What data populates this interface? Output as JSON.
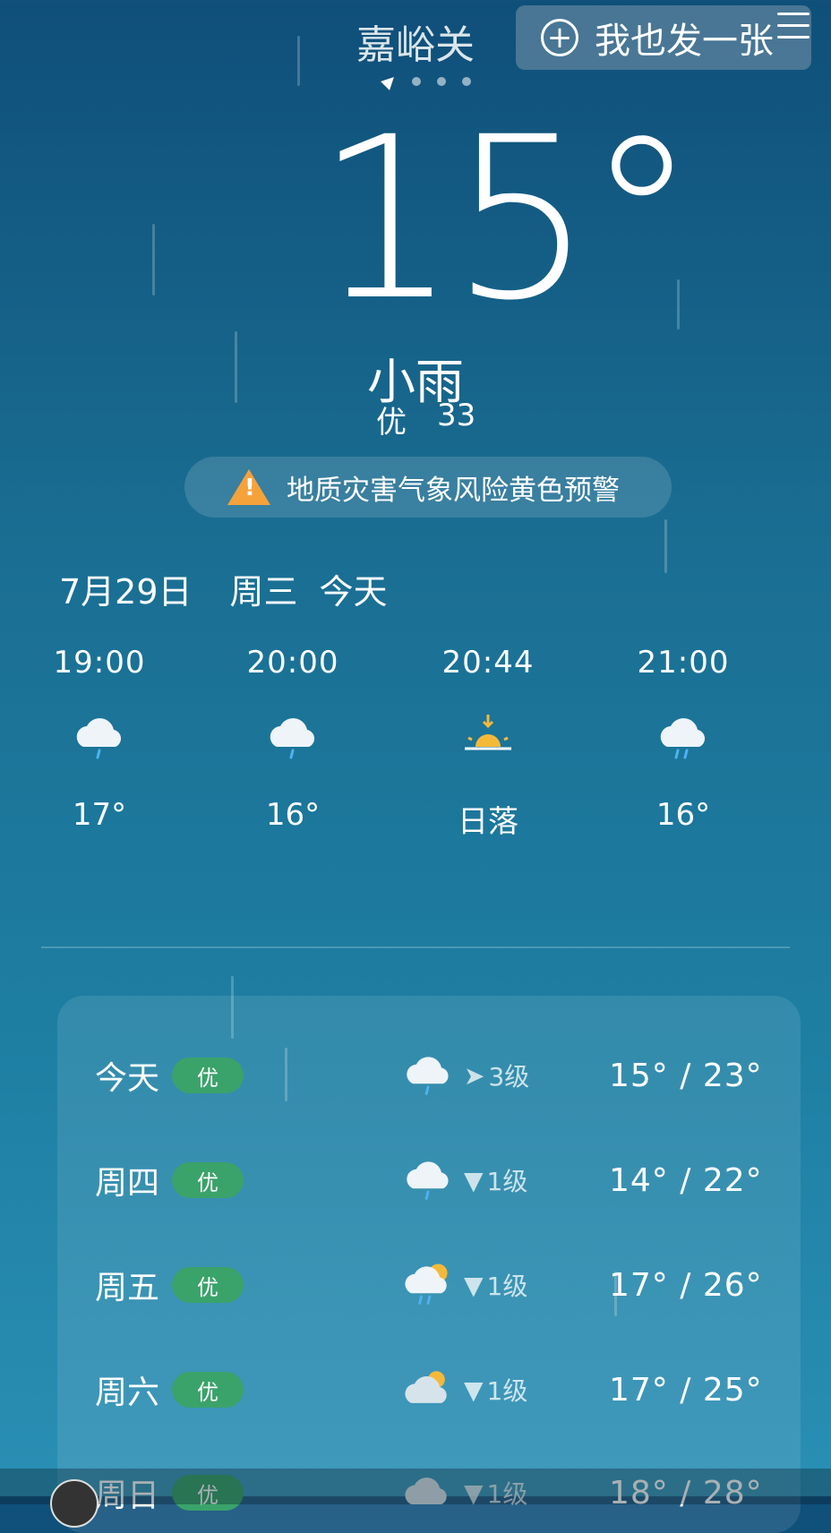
{
  "header": {
    "city": "嘉峪关",
    "post_button_label": "我也发一张",
    "post_button_icon": "plus-circle-icon",
    "menu_icon": "hamburger-menu-icon"
  },
  "current": {
    "temperature": "15°",
    "condition": "小雨",
    "aqi_label": "优",
    "aqi_value": "33"
  },
  "alert": {
    "text": "地质灾害气象风险黄色预警",
    "icon": "warning-triangle-icon",
    "color": "#f5a23a"
  },
  "date_line": {
    "date": "7月29日",
    "weekday": "周三",
    "today": "今天"
  },
  "hourly": [
    {
      "time": "19:00",
      "icon": "light-rain-cloud-icon",
      "temp": "17°"
    },
    {
      "time": "20:00",
      "icon": "light-rain-cloud-icon",
      "temp": "16°"
    },
    {
      "time": "20:44",
      "icon": "sunset-icon",
      "temp": "日落"
    },
    {
      "time": "21:00",
      "icon": "rain-cloud-icon",
      "temp": "16°"
    }
  ],
  "daily": [
    {
      "day": "今天",
      "aqi": "优",
      "icon": "light-rain-cloud-icon",
      "wind": "3级",
      "range": "15° / 23°"
    },
    {
      "day": "周四",
      "aqi": "优",
      "icon": "light-rain-cloud-icon",
      "wind": "1级",
      "range": "14° / 22°"
    },
    {
      "day": "周五",
      "aqi": "优",
      "icon": "sun-rain-cloud-icon",
      "wind": "1级",
      "range": "17° / 26°"
    },
    {
      "day": "周六",
      "aqi": "优",
      "icon": "partly-cloudy-icon",
      "wind": "1级",
      "range": "17° / 25°"
    },
    {
      "day": "周日",
      "aqi": "优",
      "icon": "cloud-icon",
      "wind": "1级",
      "range": "18° / 28°"
    }
  ],
  "colors": {
    "aqi_badge": "#3aa36a",
    "background_top": "#0f4f7a",
    "background_bottom": "#2a8fb4"
  }
}
